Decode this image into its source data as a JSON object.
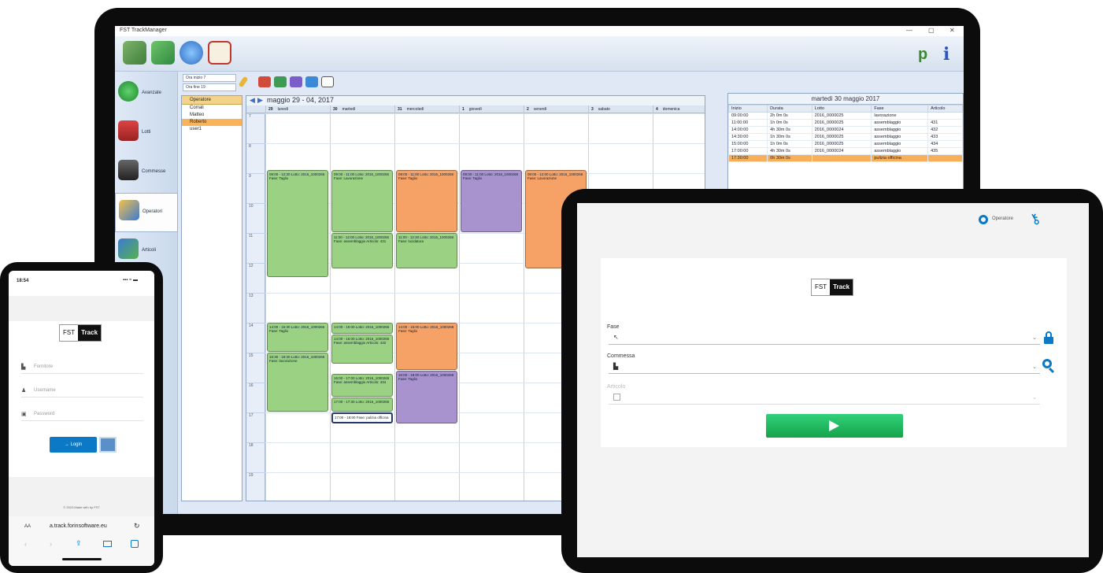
{
  "app": {
    "title": "FST TrackManager",
    "window_controls": [
      "—",
      "▢",
      "✕"
    ]
  },
  "toolbar": {
    "icons": [
      "exit-icon",
      "download-icon",
      "refresh-icon",
      "checklist-icon"
    ],
    "right_icons": [
      "user-icon",
      "info-icon"
    ],
    "right_text": [
      "p",
      "i"
    ]
  },
  "sidebar": {
    "items": [
      {
        "label": "Avanzate",
        "icon": "check-icon",
        "selected": false
      },
      {
        "label": "Lotti",
        "icon": "truck-icon",
        "selected": false
      },
      {
        "label": "Commesse",
        "icon": "binder-icon",
        "selected": false
      },
      {
        "label": "Operatori",
        "icon": "users-icon",
        "selected": true
      },
      {
        "label": "Articoli",
        "icon": "group-icon",
        "selected": false
      }
    ]
  },
  "options": {
    "first": "Ora inizio 7",
    "second": "Ora fine 19"
  },
  "operators": {
    "header": "Operatore",
    "items": [
      "Corrali",
      "Matteo",
      "Roberto",
      "user1"
    ],
    "selected_index": 2
  },
  "calendar": {
    "header": "maggio 29 - 04, 2017",
    "days": [
      {
        "num": "29",
        "name": "lunedì"
      },
      {
        "num": "30",
        "name": "martedì"
      },
      {
        "num": "31",
        "name": "mercoledì"
      },
      {
        "num": "1",
        "name": "giovedì"
      },
      {
        "num": "2",
        "name": "venerdì"
      },
      {
        "num": "3",
        "name": "sabato"
      },
      {
        "num": "4",
        "name": "domenica"
      }
    ],
    "hours": [
      "7",
      "8",
      "9",
      "10",
      "11",
      "12",
      "13",
      "14",
      "15",
      "16",
      "17",
      "18",
      "19"
    ],
    "events": [
      {
        "day": 0,
        "start": 8.9,
        "end": 12.5,
        "color": "green",
        "text": "09:00 - 12:30 Lotto: 2016_1000265 Fase: Taglio"
      },
      {
        "day": 1,
        "start": 8.9,
        "end": 11.0,
        "color": "green",
        "text": "09:00 - 11:00 Lotto: 2016_1000265 Fase: Lavorazione"
      },
      {
        "day": 1,
        "start": 11.0,
        "end": 12.2,
        "color": "green",
        "text": "11:00 - 12:00 Lotto: 2016_1000265 Fase: assemblaggio Articolo: 431"
      },
      {
        "day": 2,
        "start": 8.9,
        "end": 11.0,
        "color": "orange",
        "text": "09:00 - 11:00 Lotto: 2016_1000268 Fase: Taglio"
      },
      {
        "day": 2,
        "start": 11.0,
        "end": 12.2,
        "color": "green",
        "text": "11:00 - 12:30 Lotto: 2016_1000268 Fase: lucidatura"
      },
      {
        "day": 3,
        "start": 8.9,
        "end": 11.0,
        "color": "purple",
        "text": "09:00 - 11:00 Lotto: 2016_1000268 Fase: Taglio"
      },
      {
        "day": 4,
        "start": 8.9,
        "end": 12.2,
        "color": "orange",
        "text": "09:00 - 12:00 Lotto: 2016_1000268 Fase: Lavorazione"
      },
      {
        "day": 0,
        "start": 14.0,
        "end": 15.0,
        "color": "green",
        "text": "14:00 - 15:30 Lotto: 2016_1000265 Fase: Taglio"
      },
      {
        "day": 0,
        "start": 15.0,
        "end": 17.0,
        "color": "green",
        "text": "15:30 - 18:30 Lotto: 2016_1000265 Fase: lavorazione"
      },
      {
        "day": 1,
        "start": 14.0,
        "end": 14.4,
        "color": "green",
        "text": "14:00 - 15:00 Lotto: 2016_1000265"
      },
      {
        "day": 1,
        "start": 14.4,
        "end": 15.4,
        "color": "green",
        "text": "14:00 - 16:00 Lotto: 2016_1000265 Fase: assemblaggio Articolo: 432"
      },
      {
        "day": 1,
        "start": 15.7,
        "end": 16.5,
        "color": "green",
        "text": "16:00 - 17:00 Lotto: 2016_1000265 Fase: assemblaggio Articolo: 434"
      },
      {
        "day": 1,
        "start": 16.5,
        "end": 17.0,
        "color": "green",
        "text": "17:00 - 17:30 Lotto: 2016_1000265"
      },
      {
        "day": 1,
        "start": 17.0,
        "end": 17.4,
        "color": "white",
        "text": "17:00 - 18:00 Fase: pulizia officina"
      },
      {
        "day": 2,
        "start": 14.0,
        "end": 15.6,
        "color": "orange",
        "text": "14:00 - 16:00 Lotto: 2016_1000268 Fase: Taglio"
      },
      {
        "day": 2,
        "start": 15.6,
        "end": 17.4,
        "color": "purple",
        "text": "16:00 - 18:00 Lotto: 2016_1000268 Fase: Taglio"
      }
    ]
  },
  "day_panel": {
    "title": "martedì 30 maggio 2017",
    "columns": [
      "Inizio",
      "Durata",
      "Lotto",
      "Fase",
      "Articolo"
    ],
    "rows": [
      {
        "inizio": "09:00:00",
        "durata": "2h 0m 0s",
        "lotto": "2016_0000025",
        "fase": "lavorazione",
        "articolo": "",
        "hl": false
      },
      {
        "inizio": "11:00:00",
        "durata": "1h 0m 0s",
        "lotto": "2016_0000025",
        "fase": "assemblaggio",
        "articolo": "431",
        "hl": false
      },
      {
        "inizio": "14:00:00",
        "durata": "4h 30m 0s",
        "lotto": "2016_0000024",
        "fase": "assemblaggio",
        "articolo": "432",
        "hl": false
      },
      {
        "inizio": "14:30:00",
        "durata": "1h 30m 0s",
        "lotto": "2016_0000025",
        "fase": "assemblaggio",
        "articolo": "433",
        "hl": false
      },
      {
        "inizio": "15:00:00",
        "durata": "1h 0m 0s",
        "lotto": "2016_0000025",
        "fase": "assemblaggio",
        "articolo": "434",
        "hl": false
      },
      {
        "inizio": "17:00:00",
        "durata": "4h 30m 0s",
        "lotto": "2016_0000024",
        "fase": "assemblaggio",
        "articolo": "435",
        "hl": false
      },
      {
        "inizio": "17:30:00",
        "durata": "0h 30m 0s",
        "lotto": "",
        "fase": "pulizia officina",
        "articolo": "",
        "hl": true
      }
    ]
  },
  "tablet": {
    "user_label": "Operatore",
    "logo": {
      "left": "FST",
      "right": "Track"
    },
    "fase_label": "Fase",
    "commessa_label": "Commessa",
    "articolo_label": "Articolo",
    "fase_icon": "cursor-icon",
    "commessa_icon": "document-icon",
    "articolo_icon": "box-icon",
    "colors": {
      "accent": "#0b79c6",
      "play": "#22c55e"
    }
  },
  "phone": {
    "time": "18:54",
    "status": "▪▪▪ ≈ ▬",
    "logo": {
      "left": "FST",
      "right": "Track"
    },
    "placeholders": [
      "Fornitore",
      "Username",
      "Password"
    ],
    "login_label": "→ Login",
    "footer": "© 2023 Made with by FST",
    "address_prefix": "AA",
    "address": "a.track.forinsoftware.eu"
  }
}
